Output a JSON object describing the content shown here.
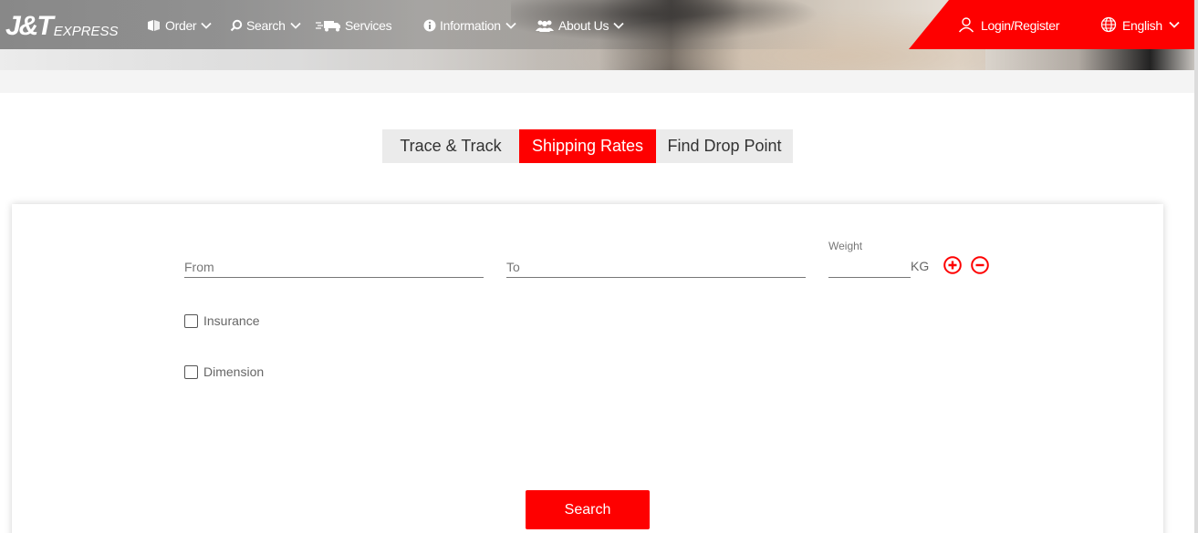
{
  "header": {
    "logo": {
      "main": "J&T",
      "sub": "EXPRESS"
    },
    "nav": [
      {
        "label": "Order",
        "icon": "order-icon",
        "has_dropdown": true
      },
      {
        "label": "Search",
        "icon": "search-icon",
        "has_dropdown": true
      },
      {
        "label": "Services",
        "icon": "truck-icon",
        "has_dropdown": false
      },
      {
        "label": "Information",
        "icon": "info-icon",
        "has_dropdown": true
      },
      {
        "label": "About Us",
        "icon": "people-icon",
        "has_dropdown": true
      }
    ],
    "login_label": "Login/Register",
    "language_label": "English"
  },
  "tabs": [
    {
      "label": "Trace & Track",
      "active": false
    },
    {
      "label": "Shipping Rates",
      "active": true
    },
    {
      "label": "Find Drop Point",
      "active": false
    }
  ],
  "form": {
    "from_placeholder": "From",
    "to_placeholder": "To",
    "weight_label": "Weight",
    "weight_value": "",
    "weight_unit": "KG",
    "insurance_label": "Insurance",
    "insurance_checked": false,
    "dimension_label": "Dimension",
    "dimension_checked": false,
    "search_button": "Search"
  },
  "colors": {
    "brand_red": "#fe0000",
    "tab_inactive": "#ebebeb"
  }
}
